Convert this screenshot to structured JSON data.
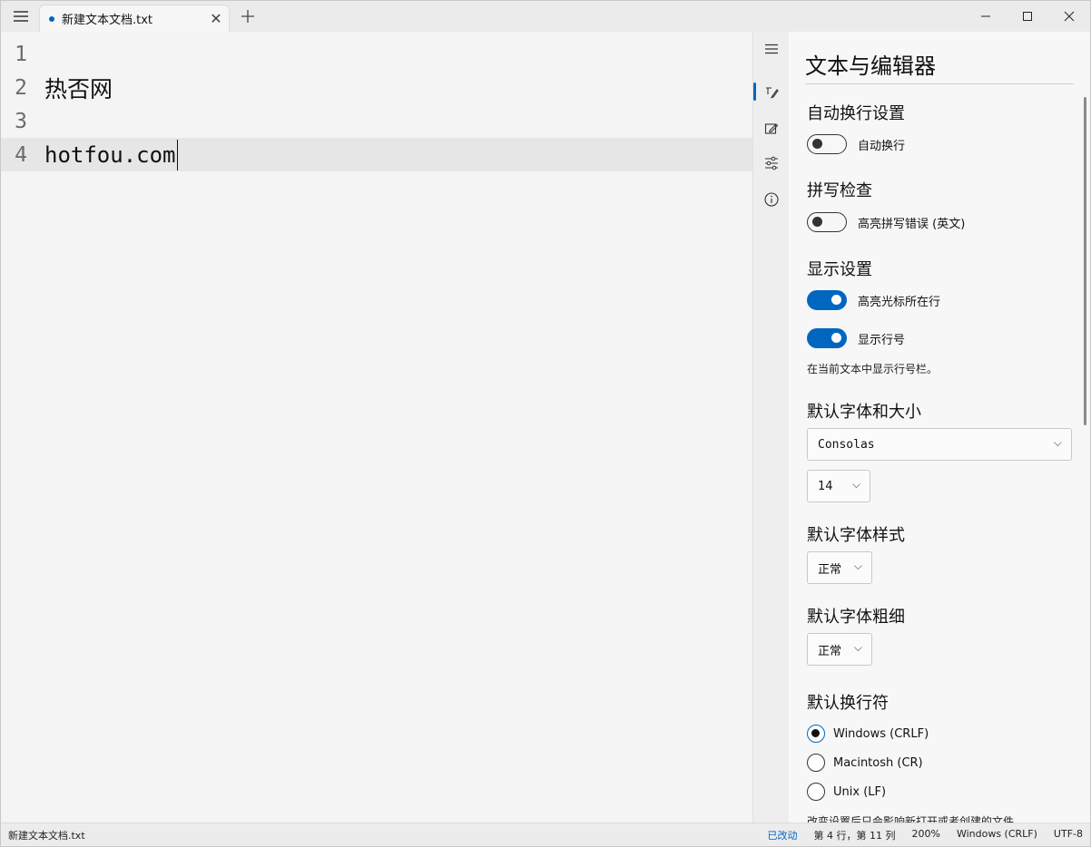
{
  "tab": {
    "title": "新建文本文档.txt"
  },
  "editor": {
    "lines": [
      {
        "num": "1",
        "text": ""
      },
      {
        "num": "2",
        "text": "热否网"
      },
      {
        "num": "3",
        "text": ""
      },
      {
        "num": "4",
        "text": "hotfou.com"
      }
    ]
  },
  "settings": {
    "title": "文本与编辑器",
    "wrap": {
      "heading": "自动换行设置",
      "toggle_label": "自动换行",
      "on": false
    },
    "spell": {
      "heading": "拼写检查",
      "toggle_label": "高亮拼写错误 (英文)",
      "on": false
    },
    "display": {
      "heading": "显示设置",
      "highlight_label": "高亮光标所在行",
      "highlight_on": true,
      "linenum_label": "显示行号",
      "linenum_on": true,
      "hint": "在当前文本中显示行号栏。"
    },
    "font": {
      "heading": "默认字体和大小",
      "family": "Consolas",
      "size": "14"
    },
    "style": {
      "heading": "默认字体样式",
      "value": "正常"
    },
    "weight": {
      "heading": "默认字体粗细",
      "value": "正常"
    },
    "eol": {
      "heading": "默认换行符",
      "options": [
        "Windows (CRLF)",
        "Macintosh (CR)",
        "Unix (LF)"
      ],
      "selected": "Windows (CRLF)",
      "note": "改变设置后只会影响新打开或者创建的文件"
    }
  },
  "status": {
    "file": "新建文本文档.txt",
    "modified": "已改动",
    "position": "第 4 行，第 11 列",
    "zoom": "200%",
    "eol": "Windows (CRLF)",
    "encoding": "UTF-8"
  },
  "colors": {
    "accent": "#0067c0"
  }
}
